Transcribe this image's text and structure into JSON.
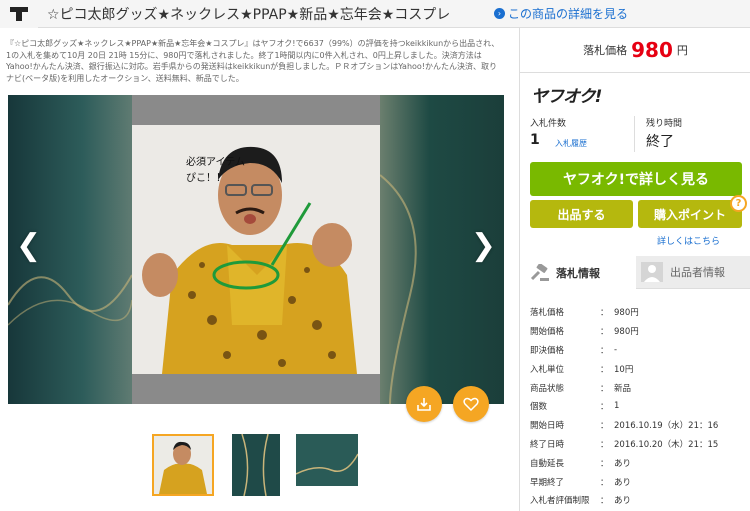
{
  "header": {
    "logo_icon": "yahoo-auction-logo-icon",
    "title": "☆ピコ太郎グッズ★ネックレス★PPAP★新品★忘年会★コスプレ",
    "detail_link": "この商品の詳細を見る"
  },
  "description": "『☆ピコ太郎グッズ★ネックレス★PPAP★新品★忘年会★コスプレ』はヤフオク!で6637（99%）の評価を持つkeikkikunから出品され、1の入札を集めて10月 20日 21時 15分に、980円で落札されました。終了1時間以内に0件入札され、0円上昇しました。決済方法はYahoo!かんたん決済、銀行振込に対応。岩手県からの発送料はkeikkikunが負担しました。ＰＲオプションはYahoo!かんたん決済、取りナビ(ベータ版)を利用したオークション、送料無料、新品でした。",
  "gallery": {
    "prev_icon": "chevron-left-icon",
    "next_icon": "chevron-right-icon",
    "caption": "必須アイテム\nぴこ！！",
    "save_icon": "download-icon",
    "watch_icon": "heart-icon"
  },
  "side": {
    "price_label": "落札価格",
    "price_value": "980",
    "price_unit": "円",
    "brand": "ヤフオク!",
    "bid_count_label": "入札件数",
    "bid_count": "1",
    "bid_history": "入札履歴",
    "time_label": "残り時間",
    "time_value": "終了",
    "main_button": "ヤフオク!で詳しく見る",
    "bid_button": "出品する",
    "points_button": "購入ポイント",
    "help_icon": "?",
    "more_link": "詳しくはこちら",
    "tab_bid": "落札情報",
    "tab_seller": "出品者情報"
  },
  "info_rows": [
    {
      "key": "落札価格",
      "sep": "：",
      "val": "980円"
    },
    {
      "key": "開始価格",
      "sep": "：",
      "val": "980円"
    },
    {
      "key": "即決価格",
      "sep": "：",
      "val": "-"
    },
    {
      "key": "入札単位",
      "sep": "：",
      "val": "10円"
    },
    {
      "key": "商品状態",
      "sep": "：",
      "val": "新品"
    },
    {
      "key": "個数",
      "sep": "：",
      "val": "1"
    },
    {
      "key": "開始日時",
      "sep": "：",
      "val": "2016.10.19（水）21：16"
    },
    {
      "key": "終了日時",
      "sep": "：",
      "val": "2016.10.20（木）21：15"
    },
    {
      "key": "自動延長",
      "sep": "：",
      "val": "あり"
    },
    {
      "key": "早期終了",
      "sep": "：",
      "val": "あり"
    },
    {
      "key": "入札者評価制限",
      "sep": "：",
      "val": "あり"
    }
  ]
}
